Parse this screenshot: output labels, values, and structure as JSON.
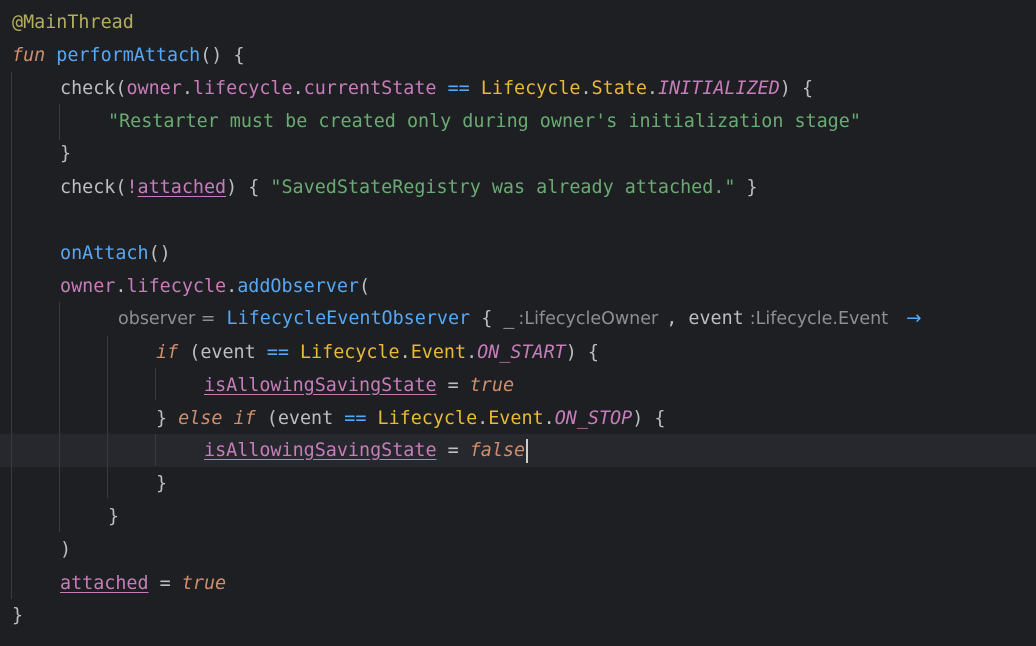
{
  "editor": {
    "language": "Kotlin",
    "theme": {
      "background": "#1e1f22",
      "caret_line": "#26282e",
      "keyword": "#cf8e6d",
      "function": "#56a8f5",
      "string": "#6aab73",
      "property": "#c77dbb",
      "class": "#e8ba36",
      "annotation": "#b3ae60",
      "hint": "#8c8f94"
    },
    "caret_line_index": 13,
    "lines": {
      "l1": {
        "annotation": "@MainThread"
      },
      "l2": {
        "kw": "fun",
        "name": "performAttach",
        "rest": "() {"
      },
      "l3": {
        "call": "check",
        "open": "(",
        "owner": "owner",
        "dot1": ".",
        "lifecycle": "lifecycle",
        "dot2": ".",
        "currentState": "currentState",
        "eq": " == ",
        "cls1": "Lifecycle",
        "dot3": ".",
        "cls2": "State",
        "dot4": ".",
        "enum": "INITIALIZED",
        "close": ") {"
      },
      "l4": {
        "str": "\"Restarter must be created only during owner's initialization stage\""
      },
      "l5": {
        "brace": "}"
      },
      "l6": {
        "call": "check",
        "open": "(",
        "not": "!",
        "var": "attached",
        "close": ") { ",
        "str": "\"SavedStateRegistry was already attached.\"",
        "end": " }"
      },
      "l8": {
        "call": "onAttach",
        "rest": "()"
      },
      "l9": {
        "owner": "owner",
        "dot1": ".",
        "lifecycle": "lifecycle",
        "dot2": ".",
        "call": "addObserver",
        "open": "("
      },
      "l10": {
        "hint_name": "observer =",
        "cls": "LifecycleEventObserver",
        "brace": " { ",
        "underscore": "_",
        "hint_type1": ":LifecycleOwner",
        "comma": ", ",
        "param": "event",
        "hint_type2": ":Lifecycle.Event",
        "arrow": "→"
      },
      "l11": {
        "kw": "if",
        "open": " (",
        "ev": "event",
        "eq": " == ",
        "cls1": "Lifecycle",
        "dot1": ".",
        "cls2": "Event",
        "dot2": ".",
        "enum": "ON_START",
        "close": ") {"
      },
      "l12": {
        "var": "isAllowingSavingState",
        "eq": " = ",
        "val": "true"
      },
      "l13": {
        "brace": "} ",
        "kw1": "else",
        "kw2": " if",
        "open": " (",
        "ev": "event",
        "eq": " == ",
        "cls1": "Lifecycle",
        "dot1": ".",
        "cls2": "Event",
        "dot2": ".",
        "enum": "ON_STOP",
        "close": ") {"
      },
      "l14": {
        "var": "isAllowingSavingState",
        "eq": " = ",
        "val": "false"
      },
      "l15": {
        "brace": "}"
      },
      "l16": {
        "brace": "}"
      },
      "l17": {
        "paren": ")"
      },
      "l18": {
        "var": "attached",
        "eq": " = ",
        "val": "true"
      },
      "l19": {
        "brace": "}"
      }
    }
  }
}
